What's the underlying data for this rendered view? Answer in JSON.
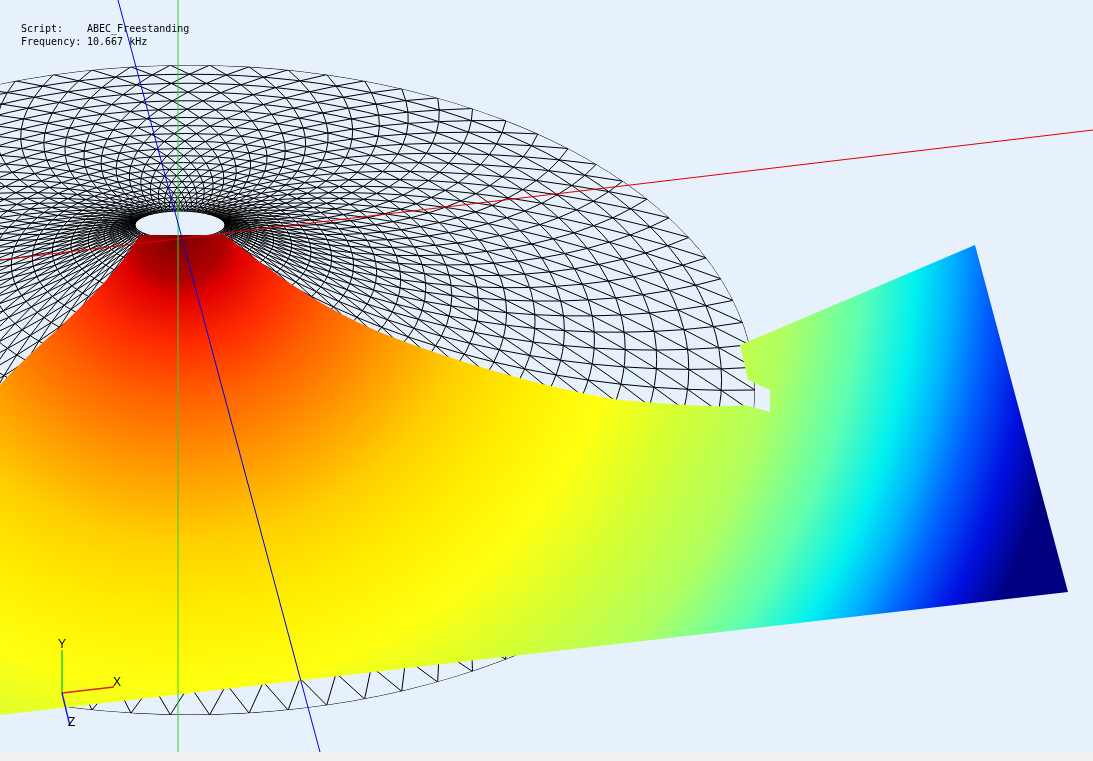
{
  "info": [
    {
      "label": "Script:",
      "value": "ABEC_Freestanding"
    },
    {
      "label": "Frequency:",
      "value": "10.667 kHz"
    }
  ],
  "axis_gizmo": {
    "labels": [
      "Y",
      "X",
      "Z"
    ]
  }
}
